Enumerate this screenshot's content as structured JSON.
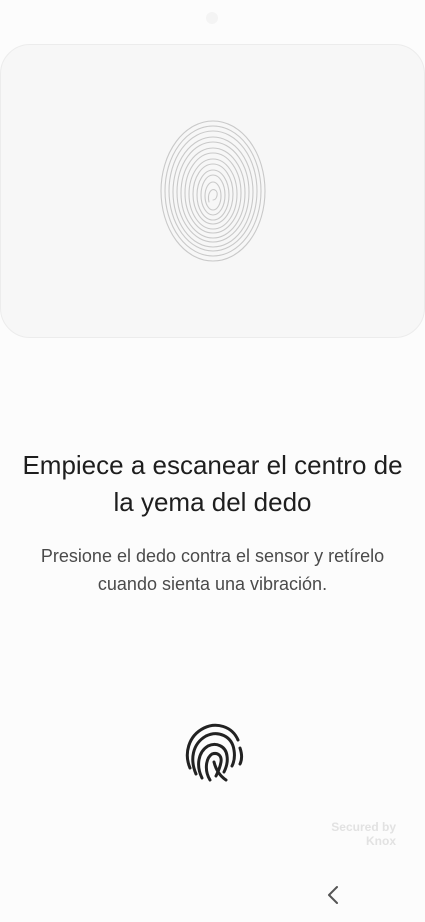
{
  "instructions": {
    "title": "Empiece a escanear el centro de la yema del dedo",
    "subtitle": "Presione el dedo contra el sensor y retírelo cuando sienta una vibración."
  },
  "branding": {
    "line1": "Secured by",
    "line2": "Knox"
  },
  "icons": {
    "card": "fingerprint-scan-icon",
    "sensor": "fingerprint-sensor-icon",
    "back": "chevron-left-icon"
  },
  "colors": {
    "background": "#fcfcfc",
    "card": "#f7f7f7",
    "text_primary": "#1e1e1e",
    "text_secondary": "#4a4a4a",
    "icon_dark": "#222222"
  }
}
